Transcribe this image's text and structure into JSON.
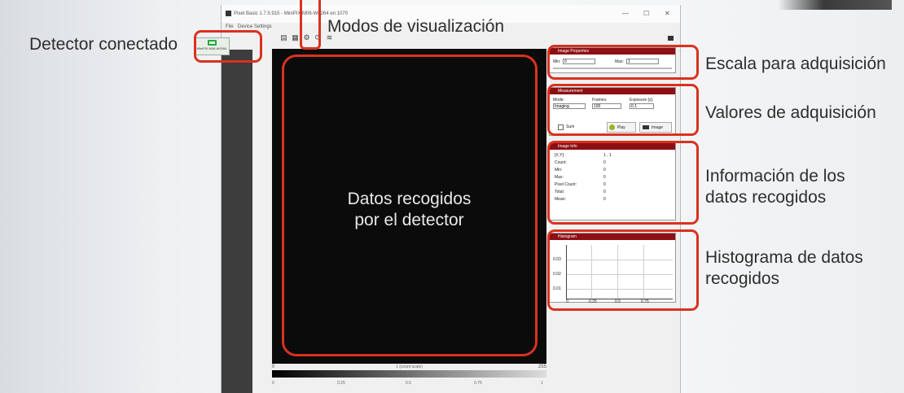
{
  "annotations": {
    "detector_connected": "Detector conectado",
    "view_modes": "Modos de visualización",
    "acquisition_scale": "Escala para adquisición",
    "acquisition_values": "Valores de adquisición",
    "data_info": "Información de los\ndatos recogidos",
    "histogram": "Histograma de datos\nrecogidos",
    "viewer_center": "Datos recogidos\npor el detector"
  },
  "colors": {
    "annotation_box": "#d9321f",
    "panel_header": "#8d0f14",
    "viewer_bg": "#0b0b0b",
    "detector_icon": "#27a845"
  },
  "window": {
    "title": "Pixet Basic 1.7.5.915 - MiniPIX M06-W0264 en 1070",
    "minimize": "—",
    "maximize": "☐",
    "close": "✕",
    "menu": [
      "File",
      "Device",
      "Settings"
    ]
  },
  "toolbar": {
    "icons": [
      "save-icon",
      "grid-icon",
      "settings-icon",
      "refresh-icon",
      "chart-icon"
    ],
    "glyphs": [
      "▤",
      "▦",
      "⚙",
      "⟳",
      "≋"
    ]
  },
  "sidebar": {
    "detector_button_label": "MiniPIX M06-W0264"
  },
  "viewer": {
    "colorbar_label": "1 (count scale)",
    "colorbar_ticks": [
      "0",
      "0.25",
      "0.5",
      "0.75",
      "1"
    ],
    "range_left": "0",
    "range_right": "255"
  },
  "panels": {
    "image_properties": {
      "title": "Image Properties",
      "min_label": "Min:",
      "min_value": "0",
      "max_label": "Max:",
      "max_value": "1"
    },
    "measurement": {
      "title": "Measurement",
      "mode_label": "Mode:",
      "mode_value": "Imaging",
      "frames_label": "Frames:",
      "frames_value": "100",
      "exposure_label": "Exposure [s]:",
      "exposure_value": "0.1",
      "sum_label": "Sum",
      "play_label": "Play",
      "image_label": "Image"
    },
    "image_info": {
      "title": "Image Info",
      "rows": [
        {
          "label": "[X,Y]:",
          "value": "1 , 1"
        },
        {
          "label": "Count:",
          "value": "0"
        },
        {
          "label": "Min:",
          "value": "0"
        },
        {
          "label": "Max:",
          "value": "0"
        },
        {
          "label": "Pixel Count:",
          "value": "0"
        },
        {
          "label": "Total:",
          "value": "0"
        },
        {
          "label": "Mean:",
          "value": "0"
        }
      ]
    },
    "histogram": {
      "title": "Histogram",
      "y_ticks": [
        "0.03",
        "0.02",
        "0.01"
      ],
      "x_ticks": [
        "0",
        "0.25",
        "0.5",
        "0.75"
      ]
    }
  }
}
